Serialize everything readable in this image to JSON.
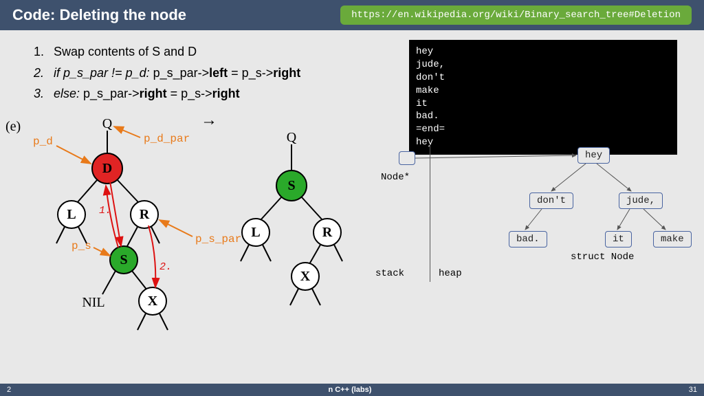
{
  "header": {
    "title": "Code: Deleting the node",
    "link": "https://en.wikipedia.org/wiki/Binary_search_tree#Deletion"
  },
  "steps": {
    "n1": "1.",
    "t1": "Swap contents of S and D",
    "n2": "2.",
    "t2a": "if p_s_par != p_d:",
    "t2b": " p_s_par->",
    "t2c": "left",
    "t2d": " = p_s->",
    "t2e": "right",
    "n3": "3.",
    "t3a": "else:",
    "t3b": " p_s_par->",
    "t3c": "right",
    "t3d": " = p_s->",
    "t3e": "right"
  },
  "e_label": "(e)",
  "terminal": [
    "hey",
    "jude,",
    "don't",
    "make",
    "it",
    "bad.",
    "=end=",
    "hey"
  ],
  "mem": {
    "stack": "stack",
    "heap": "heap",
    "nodestar": "Node*",
    "struct": "struct Node",
    "n_hey": "hey",
    "n_dont": "don't",
    "n_jude": "jude,",
    "n_bad": "bad.",
    "n_it": "it",
    "n_make": "make"
  },
  "tree": {
    "Q": "Q",
    "D": "D",
    "L": "L",
    "R": "R",
    "S": "S",
    "X": "X",
    "NIL": "NIL",
    "arrow": "→",
    "p_d": "p_d",
    "p_d_par": "p_d_par",
    "p_s": "p_s",
    "p_s_par": "p_s_par",
    "one": "1.",
    "two": "2."
  },
  "footer": {
    "left": "2",
    "mid": "n C++ (labs)",
    "right": "31"
  }
}
